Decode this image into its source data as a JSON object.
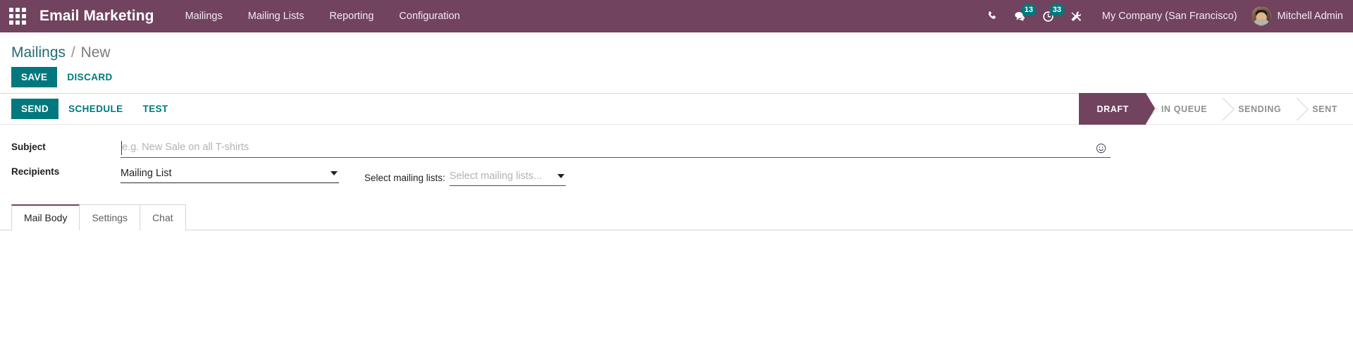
{
  "navbar": {
    "apps_icon": "apps-grid-icon",
    "brand": "Email Marketing",
    "menu": [
      {
        "label": "Mailings"
      },
      {
        "label": "Mailing Lists"
      },
      {
        "label": "Reporting"
      },
      {
        "label": "Configuration"
      }
    ],
    "sys_icons": [
      {
        "name": "phone-icon",
        "badge": null
      },
      {
        "name": "messages-icon",
        "badge": "13"
      },
      {
        "name": "activities-clock-icon",
        "badge": "33"
      },
      {
        "name": "developer-tools-icon",
        "badge": null
      }
    ],
    "company": "My Company (San Francisco)",
    "user": "Mitchell Admin",
    "colors": {
      "navbar_bg": "#71435f",
      "badge_bg": "#00787d"
    }
  },
  "breadcrumb": {
    "root": "Mailings",
    "separator": "/",
    "current": "New"
  },
  "actions": {
    "save": "SAVE",
    "discard": "DISCARD"
  },
  "statusbar": {
    "buttons": [
      {
        "label": "SEND",
        "style": "primary"
      },
      {
        "label": "SCHEDULE",
        "style": "text"
      },
      {
        "label": "TEST",
        "style": "text"
      }
    ],
    "steps": [
      {
        "label": "DRAFT",
        "active": true
      },
      {
        "label": "IN QUEUE",
        "active": false
      },
      {
        "label": "SENDING",
        "active": false
      },
      {
        "label": "SENT",
        "active": false
      }
    ],
    "active_color": "#71435f"
  },
  "form": {
    "subject": {
      "label": "Subject",
      "value": "",
      "placeholder": "e.g. New Sale on all T-shirts",
      "emoji_icon": "smiley-icon"
    },
    "recipients": {
      "label": "Recipients",
      "value": "Mailing List"
    },
    "mailing_lists": {
      "label": "Select mailing lists:",
      "value": "",
      "placeholder": "Select mailing lists..."
    }
  },
  "tabs": [
    {
      "label": "Mail Body",
      "active": true
    },
    {
      "label": "Settings",
      "active": false
    },
    {
      "label": "Chat",
      "active": false
    }
  ]
}
